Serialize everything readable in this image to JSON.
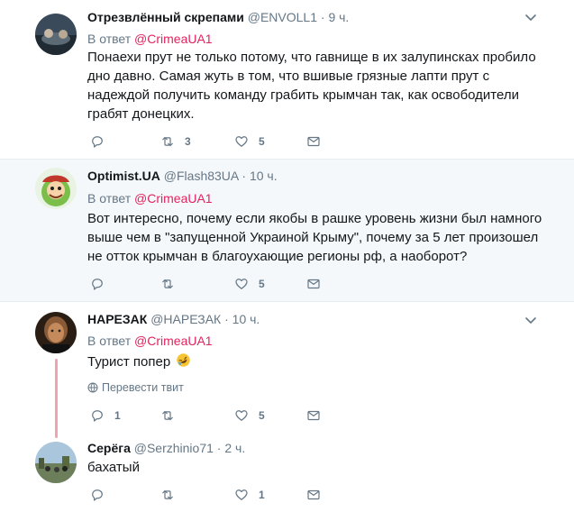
{
  "tweets": [
    {
      "name": "Отрезвлённый скрепами",
      "handle": "@ENVOLL1",
      "sep": " · ",
      "time": "9 ч.",
      "reply_prefix": "В ответ ",
      "reply_to": "@CrimeaUA1",
      "text": "Понаехи прут не только потому, что гавнище в их залупинсках пробило дно давно. Самая жуть в том, что вшивые грязные лапти прут с надеждой получить команду грабить крымчан так, как освободители грабят донецких.",
      "counts": {
        "reply": "",
        "retweet": "3",
        "like": "5"
      }
    },
    {
      "name": "Optimist.UA",
      "handle": "@Flash83UA",
      "sep": " · ",
      "time": "10 ч.",
      "reply_prefix": "В ответ ",
      "reply_to": "@CrimeaUA1",
      "text": "Вот интересно, почему если якобы в рашке уровень жизни был намного выше чем в \"запущенной Украиной Крыму\", почему за 5 лет произошел не отток крымчан в благоухающие регионы рф, а наоборот?",
      "counts": {
        "reply": "",
        "retweet": "",
        "like": "5"
      }
    },
    {
      "name": "НАРЕЗАК",
      "handle": "@НАРЕЗАК",
      "sep": " · ",
      "time": "10 ч.",
      "reply_prefix": "В ответ ",
      "reply_to": "@CrimeaUA1",
      "text": "Турист попер",
      "translate": "Перевести твит",
      "counts": {
        "reply": "1",
        "retweet": "",
        "like": "5"
      }
    },
    {
      "name": "Серёга",
      "handle": "@Serzhinio71",
      "sep": " · ",
      "time": "2 ч.",
      "text": "бахатый",
      "counts": {
        "reply": "",
        "retweet": "",
        "like": "1"
      }
    }
  ],
  "icons": {
    "reply": "reply-icon",
    "retweet": "retweet-icon",
    "like": "heart-icon",
    "dm": "envelope-icon",
    "more": "chevron-down-icon",
    "translate": "globe-icon",
    "emoji": "rolling-laughing-emoji"
  },
  "colors": {
    "mention": "#e0245e",
    "secondary": "#657786",
    "highlight_bg": "#f5f8fa",
    "thread_line": "#f0a3b5"
  }
}
